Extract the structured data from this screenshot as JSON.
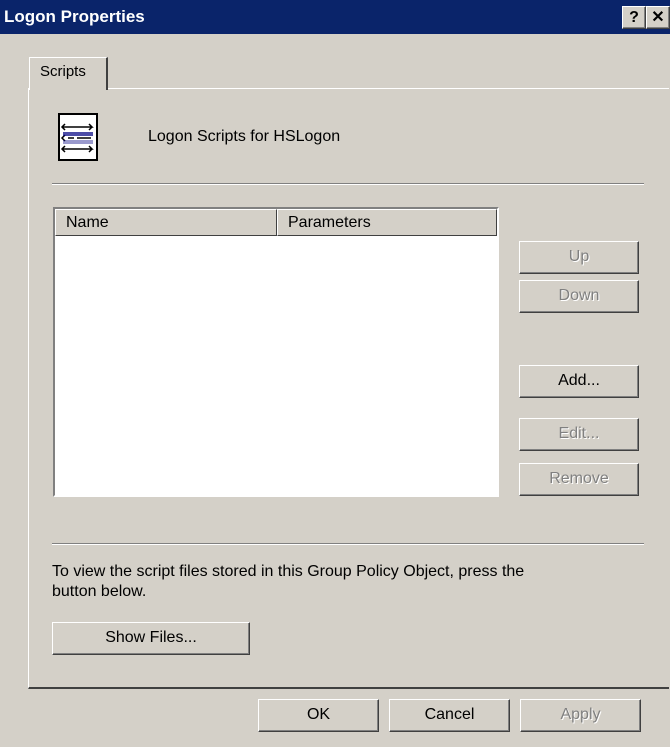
{
  "window": {
    "title": "Logon Properties"
  },
  "titlebar_buttons": {
    "help": "?",
    "close": "✕"
  },
  "tab": {
    "label": "Scripts"
  },
  "heading": "Logon Scripts for HSLogon",
  "icon": "script-document-icon",
  "list": {
    "columns": [
      "Name",
      "Parameters"
    ],
    "rows": []
  },
  "side_buttons": {
    "up": "Up",
    "down": "Down",
    "add": "Add...",
    "edit": "Edit...",
    "remove": "Remove"
  },
  "info_text": "To view the script files stored in this Group Policy Object, press the button below.",
  "show_files": "Show Files...",
  "footer": {
    "ok": "OK",
    "cancel": "Cancel",
    "apply": "Apply"
  },
  "colors": {
    "titlebar": "#0a246a",
    "face": "#d4d0c8",
    "disabled_text": "#808080"
  }
}
